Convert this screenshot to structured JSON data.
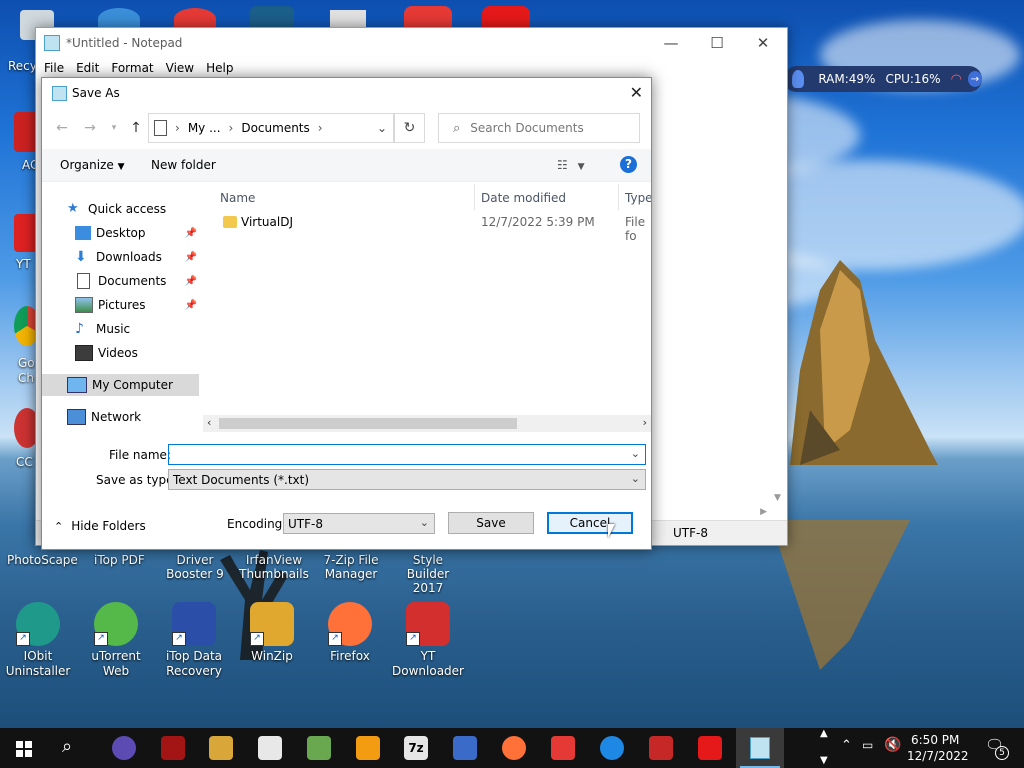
{
  "notepad": {
    "title": "*Untitled - Notepad",
    "menu": [
      "File",
      "Edit",
      "Format",
      "View",
      "Help"
    ],
    "status_encoding": "UTF-8"
  },
  "dialog": {
    "title": "Save As",
    "address": {
      "part1": "My ...",
      "part2": "Documents"
    },
    "search_placeholder": "Search Documents",
    "organize_label": "Organize",
    "new_folder_label": "New folder",
    "nav": {
      "quick_access": "Quick access",
      "desktop": "Desktop",
      "downloads": "Downloads",
      "documents": "Documents",
      "pictures": "Pictures",
      "music": "Music",
      "videos": "Videos",
      "my_computer": "My Computer",
      "network": "Network"
    },
    "columns": {
      "name": "Name",
      "date": "Date modified",
      "type": "Type"
    },
    "files": [
      {
        "name": "VirtualDJ",
        "date": "12/7/2022 5:39 PM",
        "type": "File fo"
      }
    ],
    "file_name_label": "File name:",
    "file_name_value": "",
    "save_as_type_label": "Save as type:",
    "save_as_type_value": "Text Documents (*.txt)",
    "hide_folders_label": "Hide Folders",
    "encoding_label": "Encoding:",
    "encoding_value": "UTF-8",
    "save_label": "Save",
    "cancel_label": "Cancel"
  },
  "widget": {
    "ram": "RAM:49%",
    "cpu": "CPU:16%"
  },
  "desktop": {
    "partial_left": [
      "Recy",
      "AC",
      "YT",
      "Go",
      "Ch",
      "CC"
    ],
    "row1": [
      "PhotoScape",
      "iTop PDF",
      "Driver Booster 9",
      "IrfanView Thumbnails",
      "7-Zip File Manager",
      "Style Builder 2017"
    ],
    "row2": [
      {
        "label": "IObit Uninstaller",
        "color": "#1f9a8a"
      },
      {
        "label": "uTorrent Web",
        "color": "#54b948"
      },
      {
        "label": "iTop Data Recovery",
        "color": "#2b4ea8"
      },
      {
        "label": "WinZip",
        "color": "#e0a82e"
      },
      {
        "label": "Firefox",
        "color": "#ff7139"
      },
      {
        "label": "YT Downloader",
        "color": "#d32f2f"
      }
    ]
  },
  "taskbar": {
    "time": "6:50 PM",
    "date": "12/7/2022",
    "notification_count": "5",
    "app_7z": "7z"
  }
}
